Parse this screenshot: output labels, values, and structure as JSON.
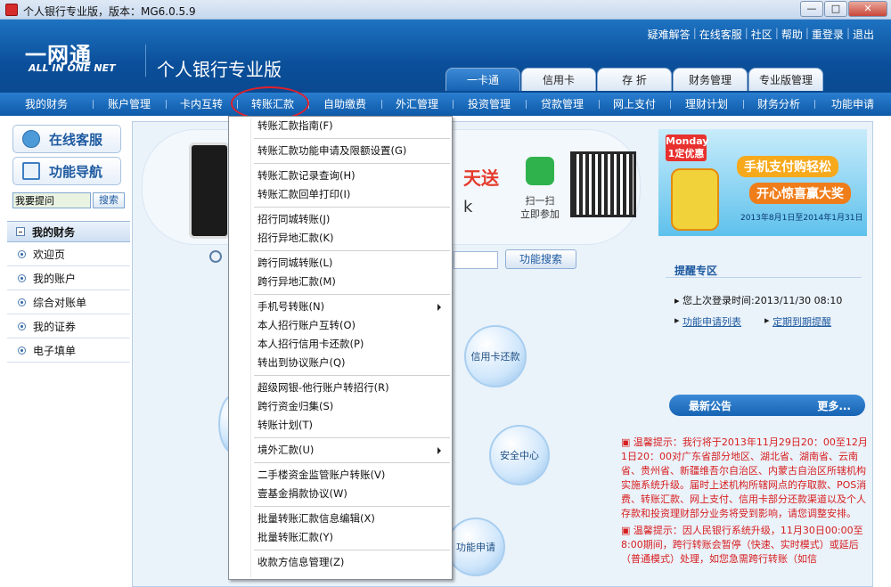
{
  "window": {
    "title": "个人银行专业版，版本：MG6.0.5.9",
    "buttons": {
      "minimize": "—",
      "maximize": "□",
      "close": "✕"
    }
  },
  "header": {
    "logo_main": "一网通",
    "logo_sub": "ALL IN ONE NET",
    "title": "个人银行专业版",
    "top_links": [
      "疑难解答",
      "在线客服",
      "社区",
      "帮助",
      "重登录",
      "退出"
    ],
    "tabs": [
      "一卡通",
      "信用卡",
      "存 折",
      "财务管理",
      "专业版管理"
    ],
    "active_tab": "一卡通"
  },
  "menubar": {
    "items": [
      "我的财务",
      "账户管理",
      "卡内互转",
      "转账汇款",
      "自助缴费",
      "外汇管理",
      "投资管理",
      "贷款管理",
      "网上支付",
      "理财计划",
      "财务分析",
      "功能申请"
    ]
  },
  "sidebar": {
    "online_service": "在线客服",
    "func_nav": "功能导航",
    "question_placeholder": "我要提问",
    "search_button": "搜索",
    "section_title": "我的财务",
    "nav_items": [
      "欢迎页",
      "我的账户",
      "综合对账单",
      "我的证券",
      "电子填单"
    ]
  },
  "banner": {
    "red_text": "天送",
    "gray_text": "k",
    "wechat_label_1": "扫一扫",
    "wechat_label_2": "立即参加"
  },
  "ad": {
    "badge_top": "Monday",
    "badge_main": "1定优惠",
    "line1": "手机支付购轻松",
    "line2": "开心惊喜赢大奖",
    "date": "2013年8月1日至2014年1月31日"
  },
  "function_search": {
    "button": "功能搜索"
  },
  "circles": {
    "credit_repay": "信用卡还款",
    "security": "安全中心",
    "apply": "功能申请"
  },
  "reminder": {
    "title": "提醒专区",
    "last_login": "您上次登录时间:2013/11/30 08:10",
    "links": [
      "功能申请列表",
      "定期到期提醒"
    ]
  },
  "news": {
    "title": "最新公告",
    "more": "更多...",
    "items": [
      "温馨提示：我行将于2013年11月29日20：00至12月1日20：00对广东省部分地区、湖北省、湖南省、云南省、贵州省、新疆维吾尔自治区、内蒙古自治区所辖机构实施系统升级。届时上述机构所辖网点的存取款、POS消费、转账汇款、网上支付、信用卡部分还款渠道以及个人存款和投资理财部分业务将受到影响，请您调整安排。",
      "温馨提示：因人民银行系统升级，11月30日00:00至8:00期间，跨行转账会暂停（快速、实时模式）或延后（普通模式）处理，如您急需跨行转账（如信"
    ]
  },
  "dropdown": {
    "groups": [
      [
        {
          "label": "转账汇款指南(F)"
        }
      ],
      [
        {
          "label": "转账汇款功能申请及限额设置(G)"
        }
      ],
      [
        {
          "label": "转账汇款记录查询(H)"
        },
        {
          "label": "转账汇款回单打印(I)"
        }
      ],
      [
        {
          "label": "招行同城转账(J)"
        },
        {
          "label": "招行异地汇款(K)"
        }
      ],
      [
        {
          "label": "跨行同城转账(L)"
        },
        {
          "label": "跨行异地汇款(M)"
        }
      ],
      [
        {
          "label": "手机号转账(N)",
          "submenu": true
        },
        {
          "label": "本人招行账户互转(O)"
        },
        {
          "label": "本人招行信用卡还款(P)"
        },
        {
          "label": "转出到协议账户(Q)"
        }
      ],
      [
        {
          "label": "超级网银-他行账户转招行(R)"
        },
        {
          "label": "跨行资金归集(S)"
        },
        {
          "label": "转账计划(T)"
        }
      ],
      [
        {
          "label": "境外汇款(U)",
          "submenu": true
        }
      ],
      [
        {
          "label": "二手楼资金监管账户转账(V)"
        },
        {
          "label": "壹基金捐款协议(W)"
        }
      ],
      [
        {
          "label": "批量转账汇款信息编辑(X)"
        },
        {
          "label": "批量转账汇款(Y)"
        }
      ],
      [
        {
          "label": "收款方信息管理(Z)"
        }
      ]
    ]
  },
  "colors": {
    "brand_blue": "#0e5aa8",
    "accent_red": "#e0202b",
    "notice_red": "#d71f1f"
  }
}
